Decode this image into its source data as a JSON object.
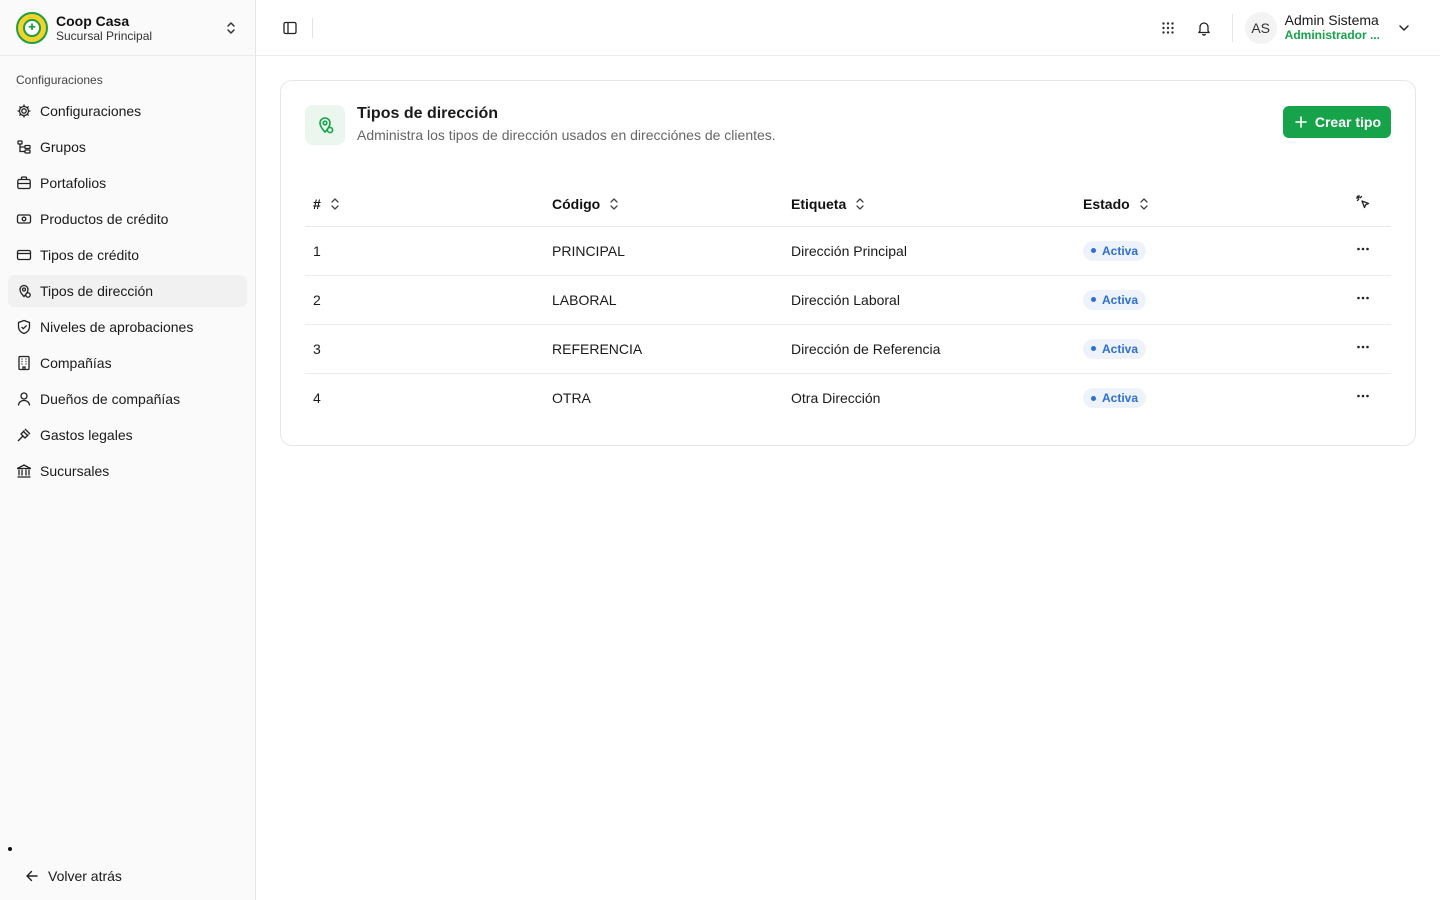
{
  "brand": {
    "name": "Coop Casa",
    "branch": "Sucursal Principal",
    "logo_text": "★"
  },
  "sidebar": {
    "group_label": "Configuraciones",
    "items": [
      {
        "label": "Configuraciones",
        "icon": "gear-icon"
      },
      {
        "label": "Grupos",
        "icon": "group-tree-icon"
      },
      {
        "label": "Portafolios",
        "icon": "briefcase-icon"
      },
      {
        "label": "Productos de crédito",
        "icon": "banknote-icon"
      },
      {
        "label": "Tipos de crédito",
        "icon": "credit-card-icon"
      },
      {
        "label": "Tipos de dirección",
        "icon": "map-pin-icon",
        "active": true
      },
      {
        "label": "Niveles de aprobaciones",
        "icon": "shield-check-icon"
      },
      {
        "label": "Compañías",
        "icon": "building-icon"
      },
      {
        "label": "Dueños de compañías",
        "icon": "user-icon"
      },
      {
        "label": "Gastos legales",
        "icon": "gavel-icon"
      },
      {
        "label": "Sucursales",
        "icon": "bank-icon"
      }
    ],
    "back_label": "Volver atrás"
  },
  "header": {
    "user_initials": "AS",
    "user_name": "Admin Sistema",
    "user_role": "Administrador ..."
  },
  "page": {
    "title": "Tipos de dirección",
    "subtitle": "Administra los tipos de dirección usados en direcciónes de clientes.",
    "create_label": "Crear tipo"
  },
  "table": {
    "columns": [
      "#",
      "Código",
      "Etiqueta",
      "Estado"
    ],
    "rows": [
      {
        "num": "1",
        "code": "PRINCIPAL",
        "label": "Dirección Principal",
        "status": "Activa"
      },
      {
        "num": "2",
        "code": "LABORAL",
        "label": "Dirección Laboral",
        "status": "Activa"
      },
      {
        "num": "3",
        "code": "REFERENCIA",
        "label": "Dirección de Referencia",
        "status": "Activa"
      },
      {
        "num": "4",
        "code": "OTRA",
        "label": "Otra Dirección",
        "status": "Activa"
      }
    ]
  },
  "colors": {
    "accent": "#16a34a",
    "badge_text": "#2e6fd6",
    "badge_bg": "#eef3fb"
  }
}
